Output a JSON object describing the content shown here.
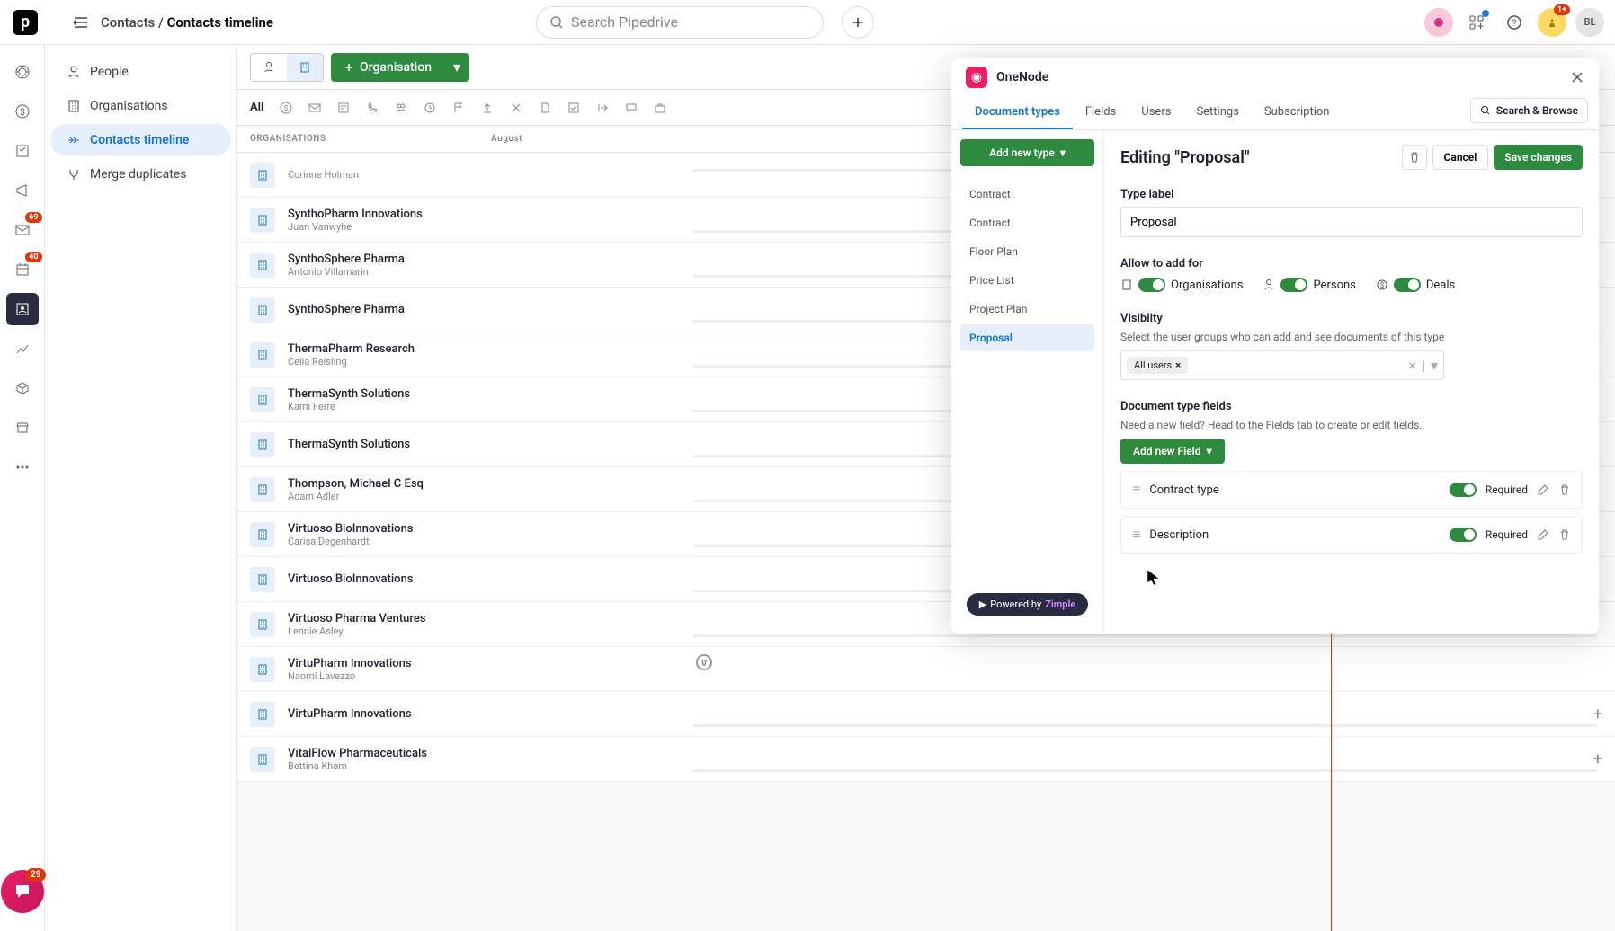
{
  "header": {
    "breadcrumb_parent": "Contacts",
    "breadcrumb_current": "Contacts timeline",
    "search_placeholder": "Search Pipedrive",
    "bell_badge": "1+",
    "avatar_initials": "BL"
  },
  "rail": {
    "mail_badge": "69",
    "cal_badge": "40",
    "fab_badge": "29"
  },
  "sidebar": {
    "items": [
      {
        "label": "People"
      },
      {
        "label": "Organisations"
      },
      {
        "label": "Contacts timeline"
      },
      {
        "label": "Merge duplicates"
      }
    ]
  },
  "toolbar": {
    "org_button": "Organisation",
    "filter_all": "All"
  },
  "timeline": {
    "header_label": "ORGANISATIONS",
    "month": "August"
  },
  "orgs": [
    {
      "name": "",
      "person": "Corinne Holman",
      "mode": "short"
    },
    {
      "name": "SynthoPharm Innovations",
      "person": "Juan Vanwyhe",
      "mode": "bar"
    },
    {
      "name": "SynthoSphere Pharma",
      "person": "Antonio Villamarin",
      "mode": "bar"
    },
    {
      "name": "SynthoSphere Pharma",
      "person": "",
      "mode": "bar"
    },
    {
      "name": "ThermaPharm Research",
      "person": "Celia Reisling",
      "mode": "bar"
    },
    {
      "name": "ThermaSynth Solutions",
      "person": "Kami Ferre",
      "mode": "bar"
    },
    {
      "name": "ThermaSynth Solutions",
      "person": "",
      "mode": "bar"
    },
    {
      "name": "Thompson, Michael C Esq",
      "person": "Adam Adler",
      "mode": "bar"
    },
    {
      "name": "Virtuoso BioInnovations",
      "person": "Carisa Degenhardt",
      "mode": "bar"
    },
    {
      "name": "Virtuoso BioInnovations",
      "person": "",
      "mode": "bar"
    },
    {
      "name": "Virtuoso Pharma Ventures",
      "person": "Lennie Asley",
      "mode": "bar"
    },
    {
      "name": "VirtuPharm Innovations",
      "person": "Naomi Lavezzo",
      "mode": "pin"
    },
    {
      "name": "VirtuPharm Innovations",
      "person": "",
      "mode": "plus"
    },
    {
      "name": "VitalFlow Pharmaceuticals",
      "person": "Bettina Kham",
      "mode": "plus"
    }
  ],
  "modal": {
    "title": "OneNode",
    "tabs": [
      "Document types",
      "Fields",
      "Users",
      "Settings",
      "Subscription"
    ],
    "search_browse": "Search & Browse",
    "add_type": "Add new type",
    "types": [
      "Contract",
      "Contract",
      "Floor Plan",
      "Price List",
      "Project Plan",
      "Proposal"
    ],
    "powered_prefix": "Powered by ",
    "powered_brand": "Zimple",
    "edit": {
      "title": "Editing \"Proposal\"",
      "cancel": "Cancel",
      "save": "Save changes",
      "type_label_label": "Type label",
      "type_label_value": "Proposal",
      "allow_label": "Allow to add for",
      "allow_orgs": "Organisations",
      "allow_persons": "Persons",
      "allow_deals": "Deals",
      "visibility_label": "Visiblity",
      "visibility_help": "Select the user groups who can add and see documents of this type",
      "visibility_tag": "All users",
      "fields_label": "Document type fields",
      "fields_help": "Need a new field? Head to the Fields tab to create or edit fields.",
      "add_field": "Add new Field",
      "field_rows": [
        {
          "name": "Contract type",
          "required_label": "Required"
        },
        {
          "name": "Description",
          "required_label": "Required"
        }
      ]
    }
  }
}
